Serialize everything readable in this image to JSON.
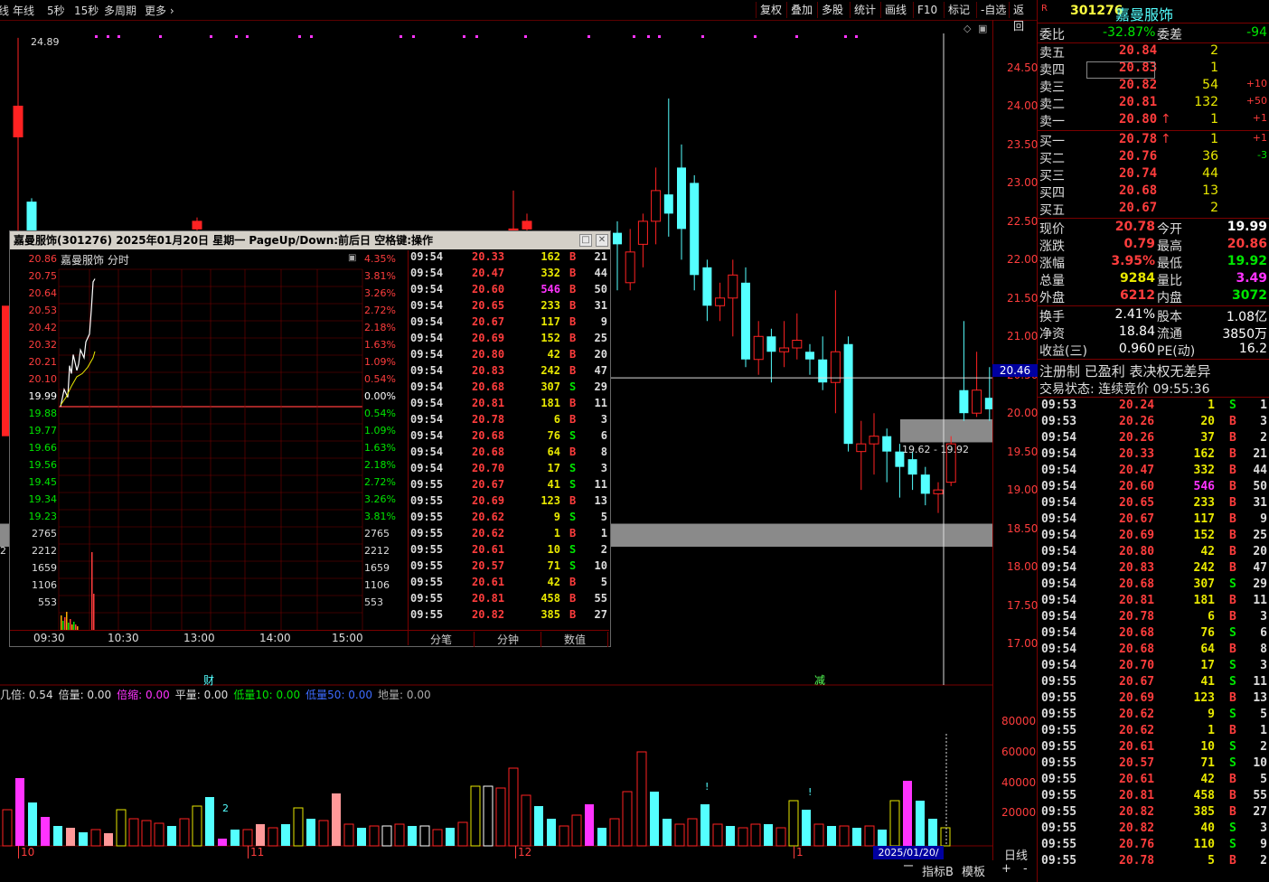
{
  "toolbar": {
    "left": [
      "线",
      "年线",
      "5秒",
      "15秒",
      "多周期",
      "更多"
    ],
    "right": [
      "复权",
      "叠加",
      "多股",
      "统计",
      "画线",
      "F10",
      "标记",
      "-自选",
      "返回"
    ]
  },
  "stock": {
    "flag": "R",
    "code": "301276",
    "name": "嘉曼服饰"
  },
  "main_chart": {
    "high_label": "24.89",
    "crosshair_price": "20.46",
    "range_label": "19.62 - 19.92",
    "y_ticks": [
      "24.50",
      "24.00",
      "23.50",
      "23.00",
      "22.50",
      "22.00",
      "21.50",
      "21.00",
      "20.50",
      "20.00",
      "19.50",
      "19.00",
      "18.50",
      "18.00",
      "17.50",
      "17.00"
    ],
    "left_edge_label": "2",
    "markers": {
      "cai": "财",
      "jian": "减"
    },
    "date_tag": "2025/01/20/一",
    "x_labels": [
      "10",
      "11",
      "12",
      "1"
    ],
    "volume_legend": [
      {
        "label": "几倍:",
        "value": "0.54",
        "color": "white"
      },
      {
        "label": "倍量:",
        "value": "0.00",
        "color": "white"
      },
      {
        "label": "倍缩:",
        "value": "0.00",
        "color": "magenta"
      },
      {
        "label": "平量:",
        "value": "0.00",
        "color": "white"
      },
      {
        "label": "低量10:",
        "value": "0.00",
        "color": "green"
      },
      {
        "label": "低量50:",
        "value": "0.00",
        "color": "blue"
      },
      {
        "label": "地量:",
        "value": "0.00",
        "color": "gray"
      }
    ],
    "volume_ticks": [
      "80000",
      "60000",
      "40000",
      "20000"
    ],
    "volume_marks": [
      "2",
      "!",
      "!"
    ]
  },
  "chart_data": {
    "type": "candlestick",
    "title": "",
    "ylim": [
      16.8,
      24.9
    ],
    "candles": [
      {
        "o": 22.35,
        "c": 22.2,
        "h": 22.5,
        "l": 21.6
      },
      {
        "o": 21.7,
        "c": 22.1,
        "h": 22.4,
        "l": 21.6
      },
      {
        "o": 22.2,
        "c": 22.5,
        "h": 22.6,
        "l": 21.9
      },
      {
        "o": 22.5,
        "c": 22.9,
        "h": 23.2,
        "l": 22.2
      },
      {
        "o": 22.85,
        "c": 22.6,
        "h": 24.1,
        "l": 22.3
      },
      {
        "o": 23.2,
        "c": 22.4,
        "h": 23.5,
        "l": 22.0
      },
      {
        "o": 23.0,
        "c": 21.8,
        "h": 23.1,
        "l": 21.6
      },
      {
        "o": 21.9,
        "c": 21.4,
        "h": 22.0,
        "l": 21.2
      },
      {
        "o": 21.4,
        "c": 21.5,
        "h": 21.7,
        "l": 21.2
      },
      {
        "o": 21.5,
        "c": 21.8,
        "h": 22.0,
        "l": 21.0
      },
      {
        "o": 21.7,
        "c": 20.7,
        "h": 21.9,
        "l": 20.6
      },
      {
        "o": 20.7,
        "c": 21.0,
        "h": 21.2,
        "l": 20.5
      },
      {
        "o": 21.0,
        "c": 20.8,
        "h": 21.1,
        "l": 20.4
      },
      {
        "o": 20.8,
        "c": 20.85,
        "h": 21.2,
        "l": 20.6
      },
      {
        "o": 20.85,
        "c": 20.95,
        "h": 21.3,
        "l": 20.7
      },
      {
        "o": 20.8,
        "c": 20.7,
        "h": 20.9,
        "l": 20.5
      },
      {
        "o": 20.7,
        "c": 20.4,
        "h": 21.0,
        "l": 20.3
      },
      {
        "o": 20.4,
        "c": 20.8,
        "h": 21.6,
        "l": 20.0
      },
      {
        "o": 20.9,
        "c": 19.6,
        "h": 21.0,
        "l": 19.5
      },
      {
        "o": 19.5,
        "c": 19.6,
        "h": 19.9,
        "l": 19.0
      },
      {
        "o": 19.6,
        "c": 19.7,
        "h": 20.0,
        "l": 19.2
      },
      {
        "o": 19.7,
        "c": 19.5,
        "h": 19.8,
        "l": 19.1
      },
      {
        "o": 19.5,
        "c": 19.3,
        "h": 19.6,
        "l": 18.9
      },
      {
        "o": 19.4,
        "c": 19.2,
        "h": 19.5,
        "l": 19.0
      },
      {
        "o": 19.2,
        "c": 18.95,
        "h": 19.3,
        "l": 18.8
      },
      {
        "o": 18.95,
        "c": 19.0,
        "h": 19.1,
        "l": 18.7
      },
      {
        "o": 19.1,
        "c": 19.6,
        "h": 19.7,
        "l": 19.05
      },
      {
        "o": 20.3,
        "c": 20.0,
        "h": 21.2,
        "l": 19.9
      },
      {
        "o": 20.0,
        "c": 20.3,
        "h": 20.8,
        "l": 19.95
      },
      {
        "o": 20.2,
        "c": 20.05,
        "h": 20.6,
        "l": 19.9
      },
      {
        "o": 19.99,
        "c": 20.78,
        "h": 20.86,
        "l": 19.92
      }
    ]
  },
  "popup": {
    "title": "嘉曼服饰(301276) 2025年01月20日 星期一 PageUp/Down:前后日 空格键:操作",
    "mini_label": "嘉曼服饰  分时",
    "left_prices": [
      "20.86",
      "20.75",
      "20.64",
      "20.53",
      "20.42",
      "20.32",
      "20.21",
      "20.10",
      "19.99",
      "19.88",
      "19.77",
      "19.66",
      "19.56",
      "19.45",
      "19.34",
      "19.23"
    ],
    "right_pct": [
      "4.35%",
      "3.81%",
      "3.26%",
      "2.72%",
      "2.18%",
      "1.63%",
      "1.09%",
      "0.54%",
      "0.00%",
      "0.54%",
      "1.09%",
      "1.63%",
      "2.18%",
      "2.72%",
      "3.26%",
      "3.81%"
    ],
    "vol_labels": [
      "2765",
      "2212",
      "1659",
      "1106",
      "553"
    ],
    "time_labels": [
      "09:30",
      "10:30",
      "13:00",
      "14:00",
      "15:00"
    ],
    "tabs": [
      "分笔",
      "分钟",
      "数值"
    ],
    "ticks": [
      {
        "t": "09:54",
        "p": "20.33",
        "v": "162",
        "bs": "B",
        "n": "21"
      },
      {
        "t": "09:54",
        "p": "20.47",
        "v": "332",
        "bs": "B",
        "n": "44"
      },
      {
        "t": "09:54",
        "p": "20.60",
        "v": "546",
        "bs": "B",
        "n": "50",
        "hl": true
      },
      {
        "t": "09:54",
        "p": "20.65",
        "v": "233",
        "bs": "B",
        "n": "31"
      },
      {
        "t": "09:54",
        "p": "20.67",
        "v": "117",
        "bs": "B",
        "n": "9"
      },
      {
        "t": "09:54",
        "p": "20.69",
        "v": "152",
        "bs": "B",
        "n": "25"
      },
      {
        "t": "09:54",
        "p": "20.80",
        "v": "42",
        "bs": "B",
        "n": "20"
      },
      {
        "t": "09:54",
        "p": "20.83",
        "v": "242",
        "bs": "B",
        "n": "47"
      },
      {
        "t": "09:54",
        "p": "20.68",
        "v": "307",
        "bs": "S",
        "n": "29"
      },
      {
        "t": "09:54",
        "p": "20.81",
        "v": "181",
        "bs": "B",
        "n": "11"
      },
      {
        "t": "09:54",
        "p": "20.78",
        "v": "6",
        "bs": "B",
        "n": "3"
      },
      {
        "t": "09:54",
        "p": "20.68",
        "v": "76",
        "bs": "S",
        "n": "6"
      },
      {
        "t": "09:54",
        "p": "20.68",
        "v": "64",
        "bs": "B",
        "n": "8"
      },
      {
        "t": "09:54",
        "p": "20.70",
        "v": "17",
        "bs": "S",
        "n": "3"
      },
      {
        "t": "09:55",
        "p": "20.67",
        "v": "41",
        "bs": "S",
        "n": "11"
      },
      {
        "t": "09:55",
        "p": "20.69",
        "v": "123",
        "bs": "B",
        "n": "13"
      },
      {
        "t": "09:55",
        "p": "20.62",
        "v": "9",
        "bs": "S",
        "n": "5"
      },
      {
        "t": "09:55",
        "p": "20.62",
        "v": "1",
        "bs": "B",
        "n": "1"
      },
      {
        "t": "09:55",
        "p": "20.61",
        "v": "10",
        "bs": "S",
        "n": "2"
      },
      {
        "t": "09:55",
        "p": "20.57",
        "v": "71",
        "bs": "S",
        "n": "10"
      },
      {
        "t": "09:55",
        "p": "20.61",
        "v": "42",
        "bs": "B",
        "n": "5"
      },
      {
        "t": "09:55",
        "p": "20.81",
        "v": "458",
        "bs": "B",
        "n": "55"
      },
      {
        "t": "09:55",
        "p": "20.82",
        "v": "385",
        "bs": "B",
        "n": "27"
      }
    ]
  },
  "quote": {
    "weibi": {
      "label": "委比",
      "value": "-32.87%",
      "label2": "委差",
      "value2": "-94"
    },
    "asks": [
      {
        "label": "卖五",
        "price": "20.84",
        "vol": "2",
        "chg": ""
      },
      {
        "label": "卖四",
        "price": "20.83",
        "vol": "1",
        "chg": ""
      },
      {
        "label": "卖三",
        "price": "20.82",
        "vol": "54",
        "chg": "+10"
      },
      {
        "label": "卖二",
        "price": "20.81",
        "vol": "132",
        "chg": "+50"
      },
      {
        "label": "卖一",
        "price": "20.80",
        "vol": "1",
        "chg": "+1",
        "arrow": "↑"
      }
    ],
    "bids": [
      {
        "label": "买一",
        "price": "20.78",
        "vol": "1",
        "chg": "+1",
        "arrow": "↑"
      },
      {
        "label": "买二",
        "price": "20.76",
        "vol": "36",
        "chg": "-3"
      },
      {
        "label": "买三",
        "price": "20.74",
        "vol": "44",
        "chg": ""
      },
      {
        "label": "买四",
        "price": "20.68",
        "vol": "13",
        "chg": ""
      },
      {
        "label": "买五",
        "price": "20.67",
        "vol": "2",
        "chg": ""
      }
    ],
    "stats": [
      {
        "l1": "现价",
        "v1": "20.78",
        "c1": "red",
        "l2": "今开",
        "v2": "19.99",
        "c2": "white"
      },
      {
        "l1": "涨跌",
        "v1": "0.79",
        "c1": "red",
        "l2": "最高",
        "v2": "20.86",
        "c2": "red"
      },
      {
        "l1": "涨幅",
        "v1": "3.95%",
        "c1": "red",
        "l2": "最低",
        "v2": "19.92",
        "c2": "green"
      },
      {
        "l1": "总量",
        "v1": "9284",
        "c1": "yellow",
        "l2": "量比",
        "v2": "3.49",
        "c2": "magenta"
      },
      {
        "l1": "外盘",
        "v1": "6212",
        "c1": "red",
        "l2": "内盘",
        "v2": "3072",
        "c2": "green"
      }
    ],
    "stats2": [
      {
        "l1": "换手",
        "v1": "2.41%",
        "l2": "股本",
        "v2": "1.08亿"
      },
      {
        "l1": "净资",
        "v1": "18.84",
        "l2": "流通",
        "v2": "3850万"
      },
      {
        "l1": "收益(三)",
        "v1": "0.960",
        "l2": "PE(动)",
        "v2": "16.2"
      }
    ],
    "info1": "注册制 已盈利 表决权无差异",
    "info2": "交易状态: 连续竞价 09:55:36",
    "ticks": [
      {
        "t": "09:53",
        "p": "20.24",
        "v": "1",
        "bs": "S",
        "n": "1"
      },
      {
        "t": "09:53",
        "p": "20.26",
        "v": "20",
        "bs": "B",
        "n": "3"
      },
      {
        "t": "09:54",
        "p": "20.26",
        "v": "37",
        "bs": "B",
        "n": "2"
      },
      {
        "t": "09:54",
        "p": "20.33",
        "v": "162",
        "bs": "B",
        "n": "21"
      },
      {
        "t": "09:54",
        "p": "20.47",
        "v": "332",
        "bs": "B",
        "n": "44"
      },
      {
        "t": "09:54",
        "p": "20.60",
        "v": "546",
        "bs": "B",
        "n": "50",
        "hl": true
      },
      {
        "t": "09:54",
        "p": "20.65",
        "v": "233",
        "bs": "B",
        "n": "31"
      },
      {
        "t": "09:54",
        "p": "20.67",
        "v": "117",
        "bs": "B",
        "n": "9"
      },
      {
        "t": "09:54",
        "p": "20.69",
        "v": "152",
        "bs": "B",
        "n": "25"
      },
      {
        "t": "09:54",
        "p": "20.80",
        "v": "42",
        "bs": "B",
        "n": "20"
      },
      {
        "t": "09:54",
        "p": "20.83",
        "v": "242",
        "bs": "B",
        "n": "47"
      },
      {
        "t": "09:54",
        "p": "20.68",
        "v": "307",
        "bs": "S",
        "n": "29"
      },
      {
        "t": "09:54",
        "p": "20.81",
        "v": "181",
        "bs": "B",
        "n": "11"
      },
      {
        "t": "09:54",
        "p": "20.78",
        "v": "6",
        "bs": "B",
        "n": "3"
      },
      {
        "t": "09:54",
        "p": "20.68",
        "v": "76",
        "bs": "S",
        "n": "6"
      },
      {
        "t": "09:54",
        "p": "20.68",
        "v": "64",
        "bs": "B",
        "n": "8"
      },
      {
        "t": "09:54",
        "p": "20.70",
        "v": "17",
        "bs": "S",
        "n": "3"
      },
      {
        "t": "09:55",
        "p": "20.67",
        "v": "41",
        "bs": "S",
        "n": "11"
      },
      {
        "t": "09:55",
        "p": "20.69",
        "v": "123",
        "bs": "B",
        "n": "13"
      },
      {
        "t": "09:55",
        "p": "20.62",
        "v": "9",
        "bs": "S",
        "n": "5"
      },
      {
        "t": "09:55",
        "p": "20.62",
        "v": "1",
        "bs": "B",
        "n": "1"
      },
      {
        "t": "09:55",
        "p": "20.61",
        "v": "10",
        "bs": "S",
        "n": "2"
      },
      {
        "t": "09:55",
        "p": "20.57",
        "v": "71",
        "bs": "S",
        "n": "10"
      },
      {
        "t": "09:55",
        "p": "20.61",
        "v": "42",
        "bs": "B",
        "n": "5"
      },
      {
        "t": "09:55",
        "p": "20.81",
        "v": "458",
        "bs": "B",
        "n": "55"
      },
      {
        "t": "09:55",
        "p": "20.82",
        "v": "385",
        "bs": "B",
        "n": "27"
      },
      {
        "t": "09:55",
        "p": "20.82",
        "v": "40",
        "bs": "S",
        "n": "3"
      },
      {
        "t": "09:55",
        "p": "20.76",
        "v": "110",
        "bs": "S",
        "n": "9"
      },
      {
        "t": "09:55",
        "p": "20.78",
        "v": "5",
        "bs": "B",
        "n": "2"
      }
    ]
  },
  "bottom": {
    "daily": "日线",
    "indicator": "指标B",
    "template": "模板",
    "plus": "+",
    "minus": "-"
  }
}
